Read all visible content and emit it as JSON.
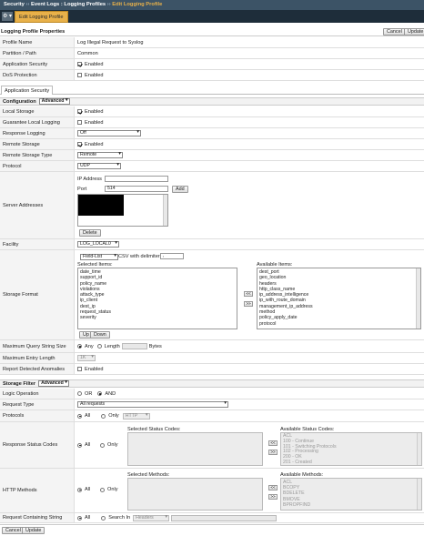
{
  "breadcrumb": {
    "section": "Security",
    "sep1": "››",
    "item1": "Event Logs : Logging Profiles",
    "sep2": "››",
    "item2": "Edit Logging Profile"
  },
  "tab": {
    "active": "Edit Logging Profile",
    "gear": "⚙ ▾"
  },
  "properties": {
    "header": "Logging Profile Properties",
    "cancel": "Cancel",
    "update": "Update",
    "rows": [
      {
        "label": "Profile Name",
        "value": "Log Illegal Request to Syslog"
      },
      {
        "label": "Partition / Path",
        "value": "Common"
      },
      {
        "label": "Application Security",
        "value": "Enabled"
      },
      {
        "label": "DoS Protection",
        "value": "Enabled"
      }
    ]
  },
  "subtab": "Application Security",
  "configuration": {
    "header": "Configuration",
    "mode": "Advanced",
    "local_storage": {
      "label": "Local Storage",
      "value": "Enabled"
    },
    "guarantee_local": {
      "label": "Guarantee Local Logging",
      "value": "Enabled"
    },
    "response_logging": {
      "label": "Response Logging",
      "value": "Off"
    },
    "remote_storage": {
      "label": "Remote Storage",
      "value": "Enabled"
    },
    "remote_storage_type": {
      "label": "Remote Storage Type",
      "value": "Remote"
    },
    "protocol": {
      "label": "Protocol",
      "value": "UDP"
    },
    "server_addresses": {
      "label": "Server Addresses",
      "ip_label": "IP Address",
      "ip_value": "",
      "port_label": "Port",
      "port_value": "514",
      "add": "Add",
      "delete": "Delete"
    },
    "facility": {
      "label": "Facility",
      "value": "LOG_LOCAL0"
    },
    "storage_format": {
      "label": "Storage Format",
      "format": "Field-List",
      "csv_label": "CSV with delimiter",
      "csv_value": ",",
      "selected_label": "Selected Items:",
      "available_label": "Available Items:",
      "selected": [
        "date_time",
        "support_id",
        "policy_name",
        "violations",
        "attack_type",
        "ip_client",
        "dest_ip",
        "request_status",
        "severity"
      ],
      "available": [
        "dest_port",
        "geo_location",
        "headers",
        "http_class_name",
        "ip_address_intelligence",
        "ip_with_route_domain",
        "management_ip_address",
        "method",
        "policy_apply_date",
        "protocol"
      ],
      "move_left": "<<",
      "move_right": ">>",
      "up": "Up",
      "down": "Down"
    },
    "max_query": {
      "label": "Maximum Query String Size",
      "any": "Any",
      "length": "Length",
      "bytes": "Bytes"
    },
    "max_entry": {
      "label": "Maximum Entry Length",
      "value": "1K"
    },
    "report_anomalies": {
      "label": "Report Detected Anomalies",
      "value": "Enabled"
    }
  },
  "storage_filter": {
    "header": "Storage Filter",
    "mode": "Advanced",
    "logic": {
      "label": "Logic Operation",
      "or": "OR",
      "and": "AND"
    },
    "request_type": {
      "label": "Request Type",
      "value": "All requests"
    },
    "protocols": {
      "label": "Protocols",
      "all": "All",
      "only": "Only",
      "value": "HTTP"
    },
    "status_codes": {
      "label": "Response Status Codes",
      "all": "All",
      "only": "Only",
      "selected_label": "Selected Status Codes:",
      "available_label": "Available Status Codes:",
      "available": [
        "ACL",
        "100 - Continue",
        "101 - Switching Protocols",
        "102 - Processing",
        "200 - OK",
        "201 - Created"
      ]
    },
    "methods": {
      "label": "HTTP Methods",
      "all": "All",
      "only": "Only",
      "selected_label": "Selected Methods:",
      "available_label": "Available Methods:",
      "available": [
        "ACL",
        "BCOPY",
        "BDELETE",
        "BMOVE",
        "BPROPFIND"
      ]
    },
    "containing": {
      "label": "Request Containing String",
      "all": "All",
      "search_in": "Search In",
      "search_field": "Headers"
    },
    "move_left": "<<",
    "move_right": ">>"
  },
  "footer": {
    "cancel": "Cancel",
    "update": "Update"
  }
}
